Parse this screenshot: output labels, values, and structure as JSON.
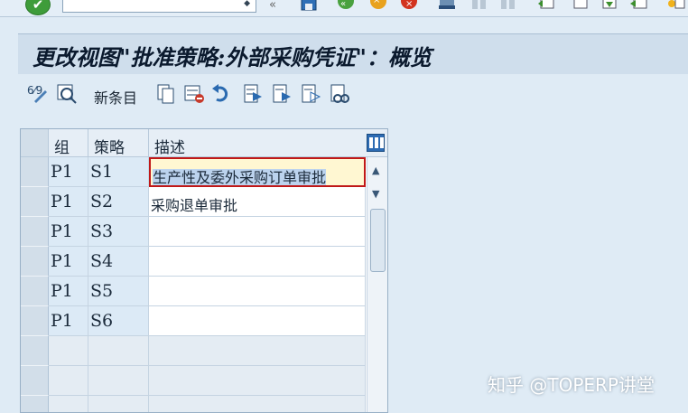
{
  "window": {
    "title": "更改视图\"批准策略:外部采购凭证\"：概览"
  },
  "system_toolbar": {
    "icons": [
      "enter-check-icon",
      "command-field-dropdown-icon",
      "back-icon",
      "save-icon",
      "back-nav-icon",
      "exit-icon",
      "cancel-icon",
      "print-icon",
      "find-icon",
      "find-next-icon",
      "first-page-icon",
      "prev-page-icon",
      "next-page-icon",
      "last-page-icon",
      "new-session-icon"
    ]
  },
  "app_toolbar": {
    "new_entries_label": "新条目",
    "icons": [
      "change-display-icon",
      "check-icon",
      "copy-as-icon",
      "delete-icon",
      "undo-change-icon",
      "select-all-icon",
      "select-block-icon",
      "deselect-all-icon",
      "print-field-icon"
    ]
  },
  "table": {
    "columns": [
      "组",
      "策略",
      "描述"
    ],
    "rows": [
      {
        "group": "P1",
        "strategy": "S1",
        "description": "生产性及委外采购订单审批"
      },
      {
        "group": "P1",
        "strategy": "S2",
        "description": "采购退单审批"
      },
      {
        "group": "P1",
        "strategy": "S3",
        "description": ""
      },
      {
        "group": "P1",
        "strategy": "S4",
        "description": ""
      },
      {
        "group": "P1",
        "strategy": "S5",
        "description": ""
      },
      {
        "group": "P1",
        "strategy": "S6",
        "description": ""
      }
    ]
  },
  "watermark": "知乎 @TOPERP讲堂",
  "colors": {
    "accent": "#2d6bb3",
    "active_cell_border": "#c01818",
    "ok_green": "#3e9c3a"
  }
}
